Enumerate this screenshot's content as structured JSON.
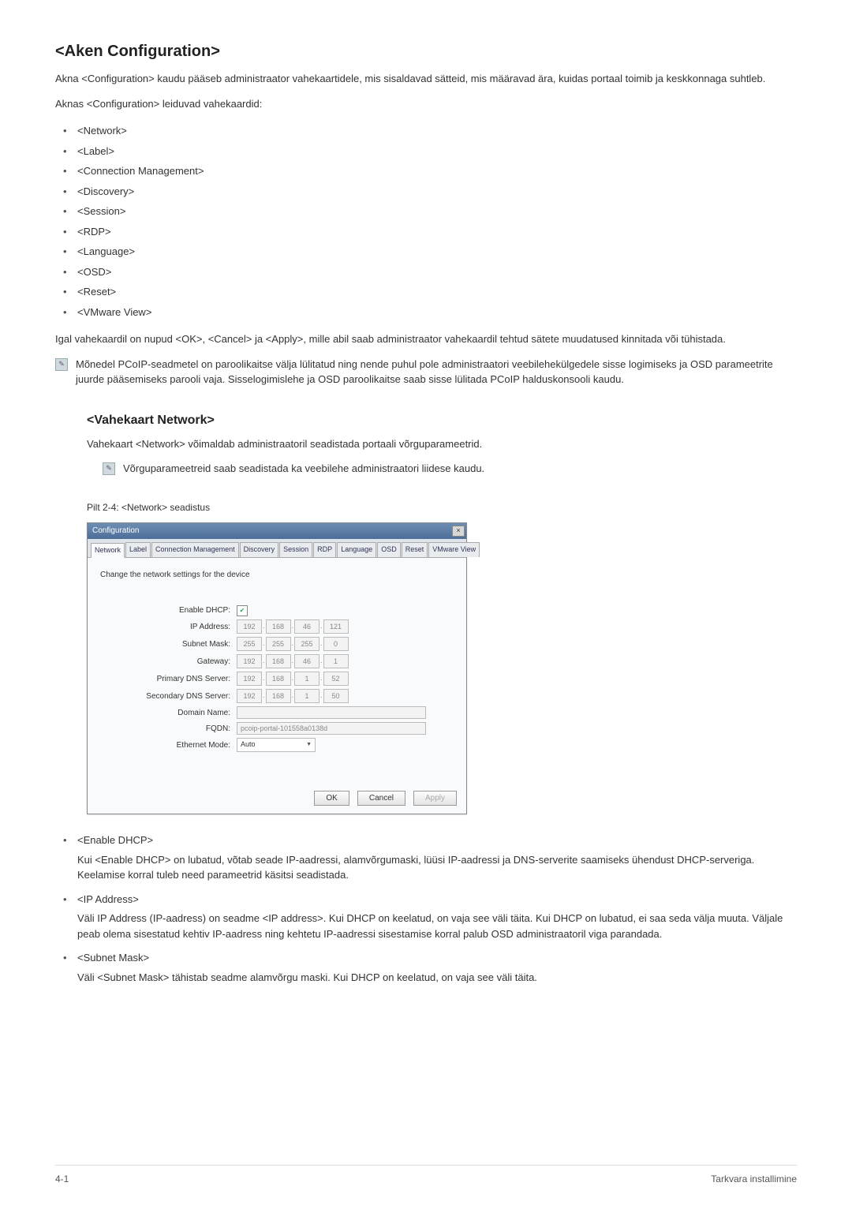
{
  "page": {
    "title": "<Aken Configuration>",
    "intro": "Akna <Configuration> kaudu pääseb administraator vahekaartidele, mis sisaldavad sätteid, mis määravad ära, kuidas portaal toimib ja keskkonnaga suhtleb.",
    "tabs_intro": "Aknas <Configuration> leiduvad vahekaardid:",
    "tabs_list": [
      "<Network>",
      "<Label>",
      "<Connection Management>",
      "<Discovery>",
      "<Session>",
      "<RDP>",
      "<Language>",
      "<OSD>",
      "<Reset>",
      "<VMware View>"
    ],
    "apply_note": "Igal vahekaardil on nupud <OK>, <Cancel> ja <Apply>, mille abil saab administraator vahekaardil tehtud sätete muudatused kinnitada või tühistada.",
    "info_note": "Mõnedel PCoIP-seadmetel on paroolikaitse välja lülitatud ning nende puhul pole administraatori veebilehekülgedele sisse logimiseks ja OSD parameetrite juurde pääsemiseks parooli vaja. Sisselogimislehe ja OSD paroolikaitse saab sisse lülitada PCoIP halduskonsooli kaudu."
  },
  "network_tab": {
    "title": "<Vahekaart Network>",
    "intro": "Vahekaart <Network> võimaldab administraatoril seadistada portaali võrguparameetrid.",
    "note": "Võrguparameetreid saab seadistada ka veebilehe administraatori liidese kaudu.",
    "fig_caption": "Pilt 2-4: <Network> seadistus"
  },
  "config_window": {
    "title": "Configuration",
    "tabs": [
      "Network",
      "Label",
      "Connection Management",
      "Discovery",
      "Session",
      "RDP",
      "Language",
      "OSD",
      "Reset",
      "VMware View"
    ],
    "desc": "Change the network settings for the device",
    "fields": {
      "enable_dhcp_label": "Enable DHCP:",
      "ip_label": "IP Address:",
      "ip": [
        "192",
        "168",
        "46",
        "121"
      ],
      "subnet_label": "Subnet Mask:",
      "subnet": [
        "255",
        "255",
        "255",
        "0"
      ],
      "gateway_label": "Gateway:",
      "gateway": [
        "192",
        "168",
        "46",
        "1"
      ],
      "pdns_label": "Primary DNS Server:",
      "pdns": [
        "192",
        "168",
        "1",
        "52"
      ],
      "sdns_label": "Secondary DNS Server:",
      "sdns": [
        "192",
        "168",
        "1",
        "50"
      ],
      "domain_label": "Domain Name:",
      "fqdn_label": "FQDN:",
      "fqdn": "pcoip-portal-101558a0138d",
      "eth_label": "Ethernet Mode:",
      "eth_value": "Auto"
    },
    "buttons": {
      "ok": "OK",
      "cancel": "Cancel",
      "apply": "Apply"
    }
  },
  "definitions": {
    "enable_dhcp": {
      "title": "<Enable DHCP>",
      "text": "Kui <Enable DHCP> on lubatud, võtab seade IP-aadressi, alamvõrgumaski, lüüsi IP-aadressi ja DNS-serverite saamiseks ühendust DHCP-serveriga. Keelamise korral tuleb need parameetrid käsitsi seadistada."
    },
    "ip_address": {
      "title": "<IP Address>",
      "text": "Väli IP Address (IP-aadress) on seadme <IP address>. Kui DHCP on keelatud, on vaja see väli täita. Kui DHCP on lubatud, ei saa seda välja muuta. Väljale peab olema sisestatud kehtiv IP-aadress ning kehtetu IP-aadressi sisestamise korral palub OSD administraatoril viga parandada."
    },
    "subnet_mask": {
      "title": "<Subnet Mask>",
      "text": "Väli <Subnet Mask> tähistab seadme alamvõrgu maski. Kui DHCP on keelatud, on vaja see väli täita."
    }
  },
  "footer": {
    "left": "4-1",
    "right": "Tarkvara installimine"
  }
}
